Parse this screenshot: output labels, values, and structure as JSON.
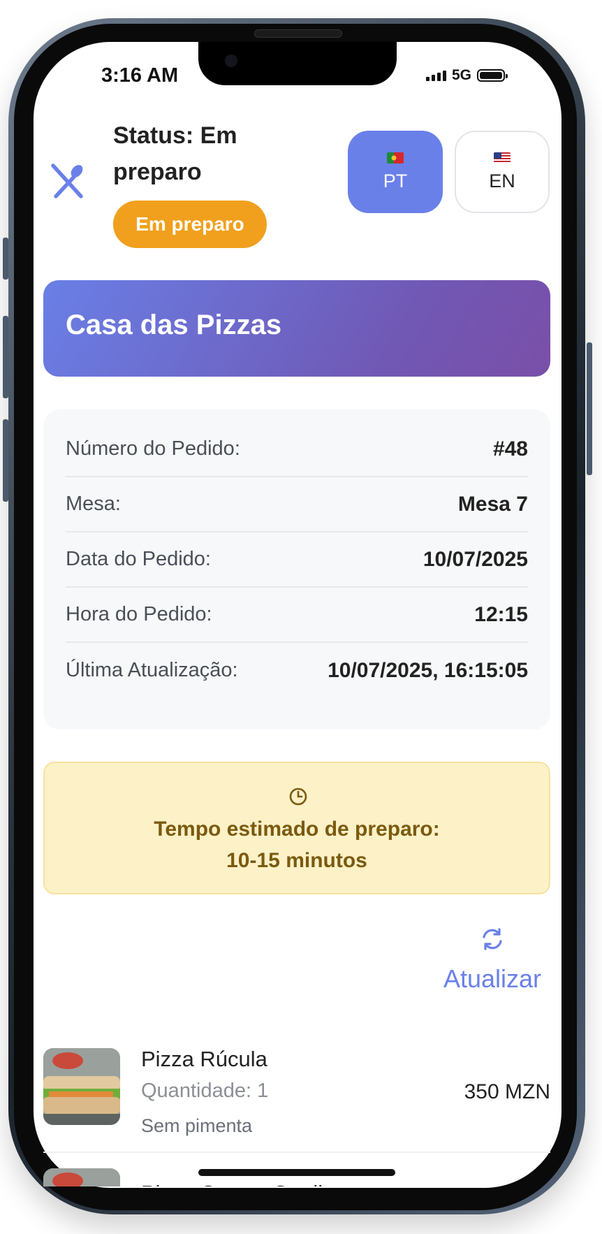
{
  "status_bar": {
    "time": "3:16 AM",
    "network": "5G"
  },
  "header": {
    "status_title": "Status: Em preparo",
    "status_badge": "Em preparo",
    "languages": [
      {
        "code": "PT",
        "flag": "portugal-flag",
        "selected": true
      },
      {
        "code": "EN",
        "flag": "us-flag",
        "selected": false
      }
    ]
  },
  "restaurant": {
    "name": "Casa das Pizzas"
  },
  "order_details": [
    {
      "label": "Número do Pedido:",
      "value": "#48"
    },
    {
      "label": "Mesa:",
      "value": "Mesa 7"
    },
    {
      "label": "Data do Pedido:",
      "value": "10/07/2025"
    },
    {
      "label": "Hora do Pedido:",
      "value": "12:15"
    },
    {
      "label": "Última Atualização:",
      "value": "10/07/2025, 16:15:05"
    }
  ],
  "estimate": {
    "label": "Tempo estimado de preparo:",
    "value": "10-15 minutos"
  },
  "refresh": {
    "label": "Atualizar"
  },
  "items": [
    {
      "name": "Pizza Rúcula",
      "quantity": "Quantidade: 1",
      "note": "Sem pimenta",
      "price": "350 MZN"
    },
    {
      "name": "Pizza Quatro Queijos"
    }
  ],
  "colors": {
    "accent": "#6a80e9",
    "badge": "#f0a01c",
    "banner_start": "#6a7fe6",
    "banner_end": "#7a4fa8",
    "estimate_bg": "#fcf1c7",
    "estimate_text": "#7b5a10"
  }
}
